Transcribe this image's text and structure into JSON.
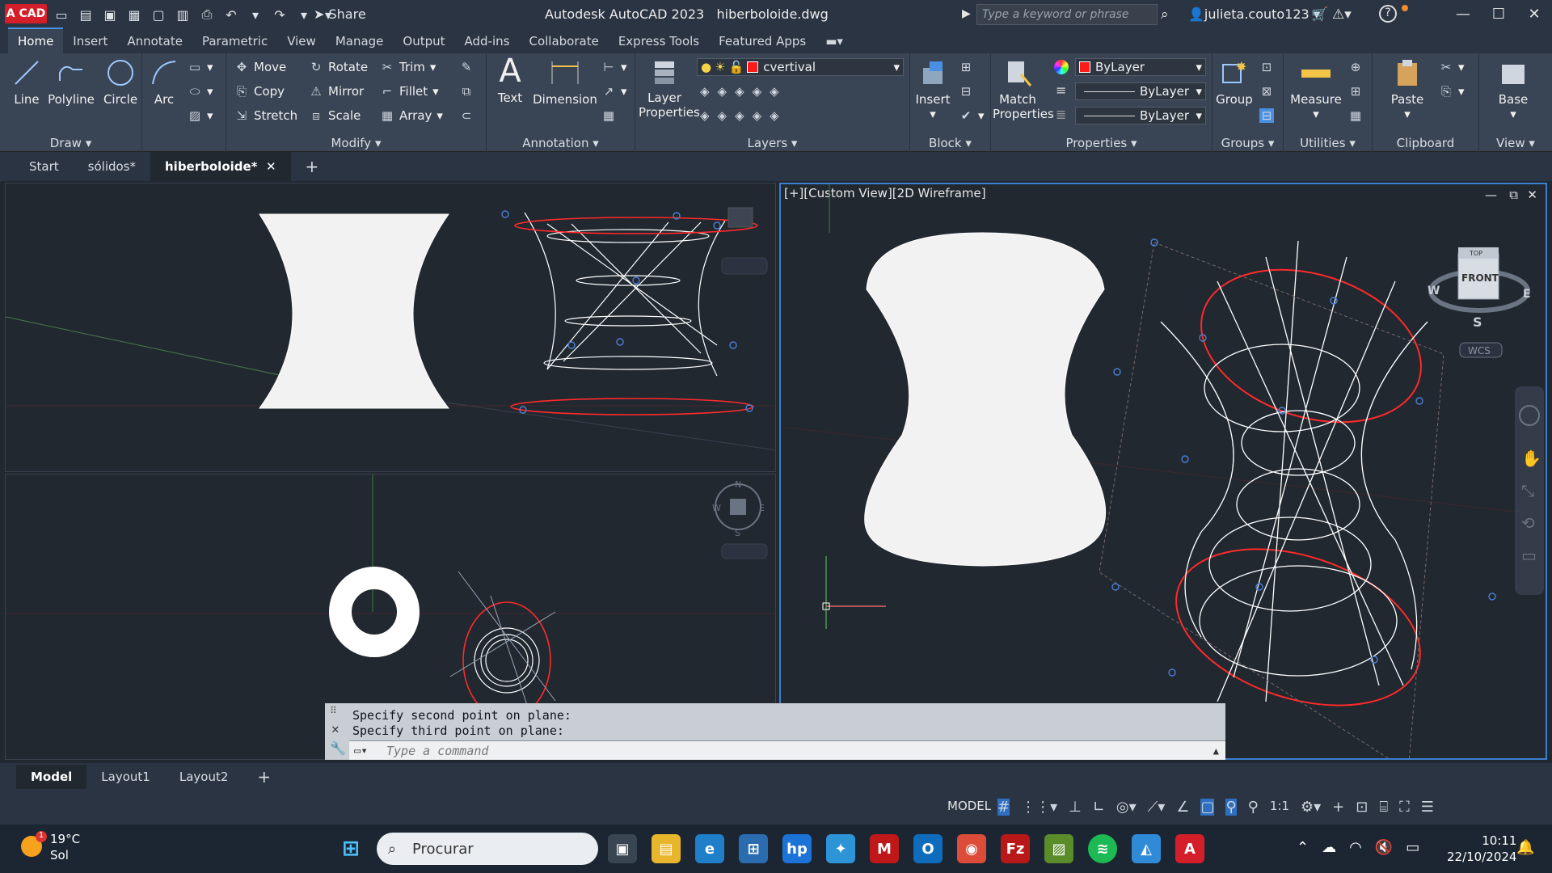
{
  "titlebar": {
    "logo": "A CAD",
    "share": "Share",
    "app_title": "Autodesk AutoCAD 2023",
    "file_title": "hiberboloide.dwg",
    "search_placeholder": "Type a keyword or phrase",
    "user": "julieta.couto123"
  },
  "ribbon_tabs": [
    "Home",
    "Insert",
    "Annotate",
    "Parametric",
    "View",
    "Manage",
    "Output",
    "Add-ins",
    "Collaborate",
    "Express Tools",
    "Featured Apps"
  ],
  "draw": {
    "title": "Draw",
    "line": "Line",
    "polyline": "Polyline",
    "circle": "Circle",
    "arc": "Arc"
  },
  "modify": {
    "title": "Modify",
    "move": "Move",
    "rotate": "Rotate",
    "trim": "Trim",
    "copy": "Copy",
    "mirror": "Mirror",
    "fillet": "Fillet",
    "stretch": "Stretch",
    "scale": "Scale",
    "array": "Array"
  },
  "annotation": {
    "title": "Annotation",
    "text": "Text",
    "dimension": "Dimension"
  },
  "layers": {
    "title": "Layers",
    "layer_properties_1": "Layer",
    "layer_properties_2": "Properties",
    "current_layer": "cvertival",
    "layer_color": "#ff1a1a"
  },
  "block": {
    "title": "Block",
    "insert": "Insert"
  },
  "properties": {
    "title": "Properties",
    "match_1": "Match",
    "match_2": "Properties",
    "color": "ByLayer",
    "linetype": "ByLayer",
    "lineweight": "ByLayer"
  },
  "groups": {
    "title": "Groups",
    "group": "Group"
  },
  "utilities": {
    "title": "Utilities",
    "measure": "Measure"
  },
  "clipboard": {
    "title": "Clipboard",
    "paste": "Paste"
  },
  "view_panel": {
    "title": "View",
    "base": "Base"
  },
  "doc_tabs": [
    "Start",
    "sólidos*",
    "hiberboloide*"
  ],
  "viewports": {
    "right_label": "[+][Custom View][2D Wireframe]",
    "viewcube_top": "TOP",
    "viewcube_front": "FRONT",
    "compass_w": "W",
    "compass_e": "E",
    "compass_s": "S",
    "compass_n": "N",
    "wcs": "WCS"
  },
  "command": {
    "line1": "Specify second point on plane:",
    "line2": "Specify third point on plane:",
    "placeholder": "Type a command"
  },
  "layout_tabs": [
    "Model",
    "Layout1",
    "Layout2"
  ],
  "status": {
    "model": "MODEL",
    "scale": "1:1"
  },
  "taskbar": {
    "temp": "19°C",
    "weather": "Sol",
    "search": "Procurar",
    "time": "10:11",
    "date": "22/10/2024",
    "badge": "1"
  }
}
